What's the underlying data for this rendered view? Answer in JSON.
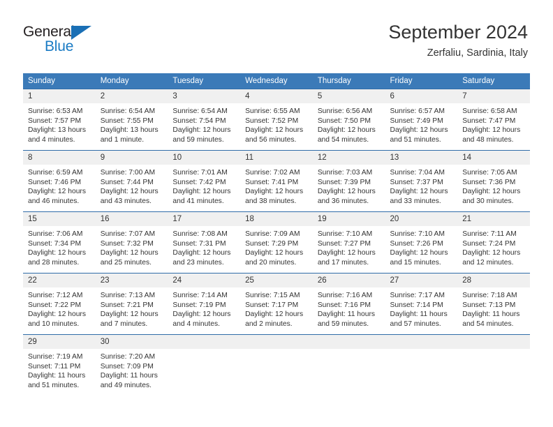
{
  "brand": {
    "name_part1": "General",
    "name_part2": "Blue",
    "accent_color": "#1a7bc4",
    "triangle_color": "#1a6fb5"
  },
  "header": {
    "title": "September 2024",
    "subtitle": "Zerfaliu, Sardinia, Italy"
  },
  "calendar": {
    "header_bg": "#3b7ab8",
    "daynum_bg": "#f0f0f0",
    "row_border_color": "#2f6ca8",
    "weekday_headers": [
      "Sunday",
      "Monday",
      "Tuesday",
      "Wednesday",
      "Thursday",
      "Friday",
      "Saturday"
    ],
    "weeks": [
      [
        {
          "day": "1",
          "sunrise": "Sunrise: 6:53 AM",
          "sunset": "Sunset: 7:57 PM",
          "daylight1": "Daylight: 13 hours",
          "daylight2": "and 4 minutes."
        },
        {
          "day": "2",
          "sunrise": "Sunrise: 6:54 AM",
          "sunset": "Sunset: 7:55 PM",
          "daylight1": "Daylight: 13 hours",
          "daylight2": "and 1 minute."
        },
        {
          "day": "3",
          "sunrise": "Sunrise: 6:54 AM",
          "sunset": "Sunset: 7:54 PM",
          "daylight1": "Daylight: 12 hours",
          "daylight2": "and 59 minutes."
        },
        {
          "day": "4",
          "sunrise": "Sunrise: 6:55 AM",
          "sunset": "Sunset: 7:52 PM",
          "daylight1": "Daylight: 12 hours",
          "daylight2": "and 56 minutes."
        },
        {
          "day": "5",
          "sunrise": "Sunrise: 6:56 AM",
          "sunset": "Sunset: 7:50 PM",
          "daylight1": "Daylight: 12 hours",
          "daylight2": "and 54 minutes."
        },
        {
          "day": "6",
          "sunrise": "Sunrise: 6:57 AM",
          "sunset": "Sunset: 7:49 PM",
          "daylight1": "Daylight: 12 hours",
          "daylight2": "and 51 minutes."
        },
        {
          "day": "7",
          "sunrise": "Sunrise: 6:58 AM",
          "sunset": "Sunset: 7:47 PM",
          "daylight1": "Daylight: 12 hours",
          "daylight2": "and 48 minutes."
        }
      ],
      [
        {
          "day": "8",
          "sunrise": "Sunrise: 6:59 AM",
          "sunset": "Sunset: 7:46 PM",
          "daylight1": "Daylight: 12 hours",
          "daylight2": "and 46 minutes."
        },
        {
          "day": "9",
          "sunrise": "Sunrise: 7:00 AM",
          "sunset": "Sunset: 7:44 PM",
          "daylight1": "Daylight: 12 hours",
          "daylight2": "and 43 minutes."
        },
        {
          "day": "10",
          "sunrise": "Sunrise: 7:01 AM",
          "sunset": "Sunset: 7:42 PM",
          "daylight1": "Daylight: 12 hours",
          "daylight2": "and 41 minutes."
        },
        {
          "day": "11",
          "sunrise": "Sunrise: 7:02 AM",
          "sunset": "Sunset: 7:41 PM",
          "daylight1": "Daylight: 12 hours",
          "daylight2": "and 38 minutes."
        },
        {
          "day": "12",
          "sunrise": "Sunrise: 7:03 AM",
          "sunset": "Sunset: 7:39 PM",
          "daylight1": "Daylight: 12 hours",
          "daylight2": "and 36 minutes."
        },
        {
          "day": "13",
          "sunrise": "Sunrise: 7:04 AM",
          "sunset": "Sunset: 7:37 PM",
          "daylight1": "Daylight: 12 hours",
          "daylight2": "and 33 minutes."
        },
        {
          "day": "14",
          "sunrise": "Sunrise: 7:05 AM",
          "sunset": "Sunset: 7:36 PM",
          "daylight1": "Daylight: 12 hours",
          "daylight2": "and 30 minutes."
        }
      ],
      [
        {
          "day": "15",
          "sunrise": "Sunrise: 7:06 AM",
          "sunset": "Sunset: 7:34 PM",
          "daylight1": "Daylight: 12 hours",
          "daylight2": "and 28 minutes."
        },
        {
          "day": "16",
          "sunrise": "Sunrise: 7:07 AM",
          "sunset": "Sunset: 7:32 PM",
          "daylight1": "Daylight: 12 hours",
          "daylight2": "and 25 minutes."
        },
        {
          "day": "17",
          "sunrise": "Sunrise: 7:08 AM",
          "sunset": "Sunset: 7:31 PM",
          "daylight1": "Daylight: 12 hours",
          "daylight2": "and 23 minutes."
        },
        {
          "day": "18",
          "sunrise": "Sunrise: 7:09 AM",
          "sunset": "Sunset: 7:29 PM",
          "daylight1": "Daylight: 12 hours",
          "daylight2": "and 20 minutes."
        },
        {
          "day": "19",
          "sunrise": "Sunrise: 7:10 AM",
          "sunset": "Sunset: 7:27 PM",
          "daylight1": "Daylight: 12 hours",
          "daylight2": "and 17 minutes."
        },
        {
          "day": "20",
          "sunrise": "Sunrise: 7:10 AM",
          "sunset": "Sunset: 7:26 PM",
          "daylight1": "Daylight: 12 hours",
          "daylight2": "and 15 minutes."
        },
        {
          "day": "21",
          "sunrise": "Sunrise: 7:11 AM",
          "sunset": "Sunset: 7:24 PM",
          "daylight1": "Daylight: 12 hours",
          "daylight2": "and 12 minutes."
        }
      ],
      [
        {
          "day": "22",
          "sunrise": "Sunrise: 7:12 AM",
          "sunset": "Sunset: 7:22 PM",
          "daylight1": "Daylight: 12 hours",
          "daylight2": "and 10 minutes."
        },
        {
          "day": "23",
          "sunrise": "Sunrise: 7:13 AM",
          "sunset": "Sunset: 7:21 PM",
          "daylight1": "Daylight: 12 hours",
          "daylight2": "and 7 minutes."
        },
        {
          "day": "24",
          "sunrise": "Sunrise: 7:14 AM",
          "sunset": "Sunset: 7:19 PM",
          "daylight1": "Daylight: 12 hours",
          "daylight2": "and 4 minutes."
        },
        {
          "day": "25",
          "sunrise": "Sunrise: 7:15 AM",
          "sunset": "Sunset: 7:17 PM",
          "daylight1": "Daylight: 12 hours",
          "daylight2": "and 2 minutes."
        },
        {
          "day": "26",
          "sunrise": "Sunrise: 7:16 AM",
          "sunset": "Sunset: 7:16 PM",
          "daylight1": "Daylight: 11 hours",
          "daylight2": "and 59 minutes."
        },
        {
          "day": "27",
          "sunrise": "Sunrise: 7:17 AM",
          "sunset": "Sunset: 7:14 PM",
          "daylight1": "Daylight: 11 hours",
          "daylight2": "and 57 minutes."
        },
        {
          "day": "28",
          "sunrise": "Sunrise: 7:18 AM",
          "sunset": "Sunset: 7:13 PM",
          "daylight1": "Daylight: 11 hours",
          "daylight2": "and 54 minutes."
        }
      ],
      [
        {
          "day": "29",
          "sunrise": "Sunrise: 7:19 AM",
          "sunset": "Sunset: 7:11 PM",
          "daylight1": "Daylight: 11 hours",
          "daylight2": "and 51 minutes."
        },
        {
          "day": "30",
          "sunrise": "Sunrise: 7:20 AM",
          "sunset": "Sunset: 7:09 PM",
          "daylight1": "Daylight: 11 hours",
          "daylight2": "and 49 minutes."
        },
        {
          "day": "",
          "sunrise": "",
          "sunset": "",
          "daylight1": "",
          "daylight2": ""
        },
        {
          "day": "",
          "sunrise": "",
          "sunset": "",
          "daylight1": "",
          "daylight2": ""
        },
        {
          "day": "",
          "sunrise": "",
          "sunset": "",
          "daylight1": "",
          "daylight2": ""
        },
        {
          "day": "",
          "sunrise": "",
          "sunset": "",
          "daylight1": "",
          "daylight2": ""
        },
        {
          "day": "",
          "sunrise": "",
          "sunset": "",
          "daylight1": "",
          "daylight2": ""
        }
      ]
    ]
  }
}
